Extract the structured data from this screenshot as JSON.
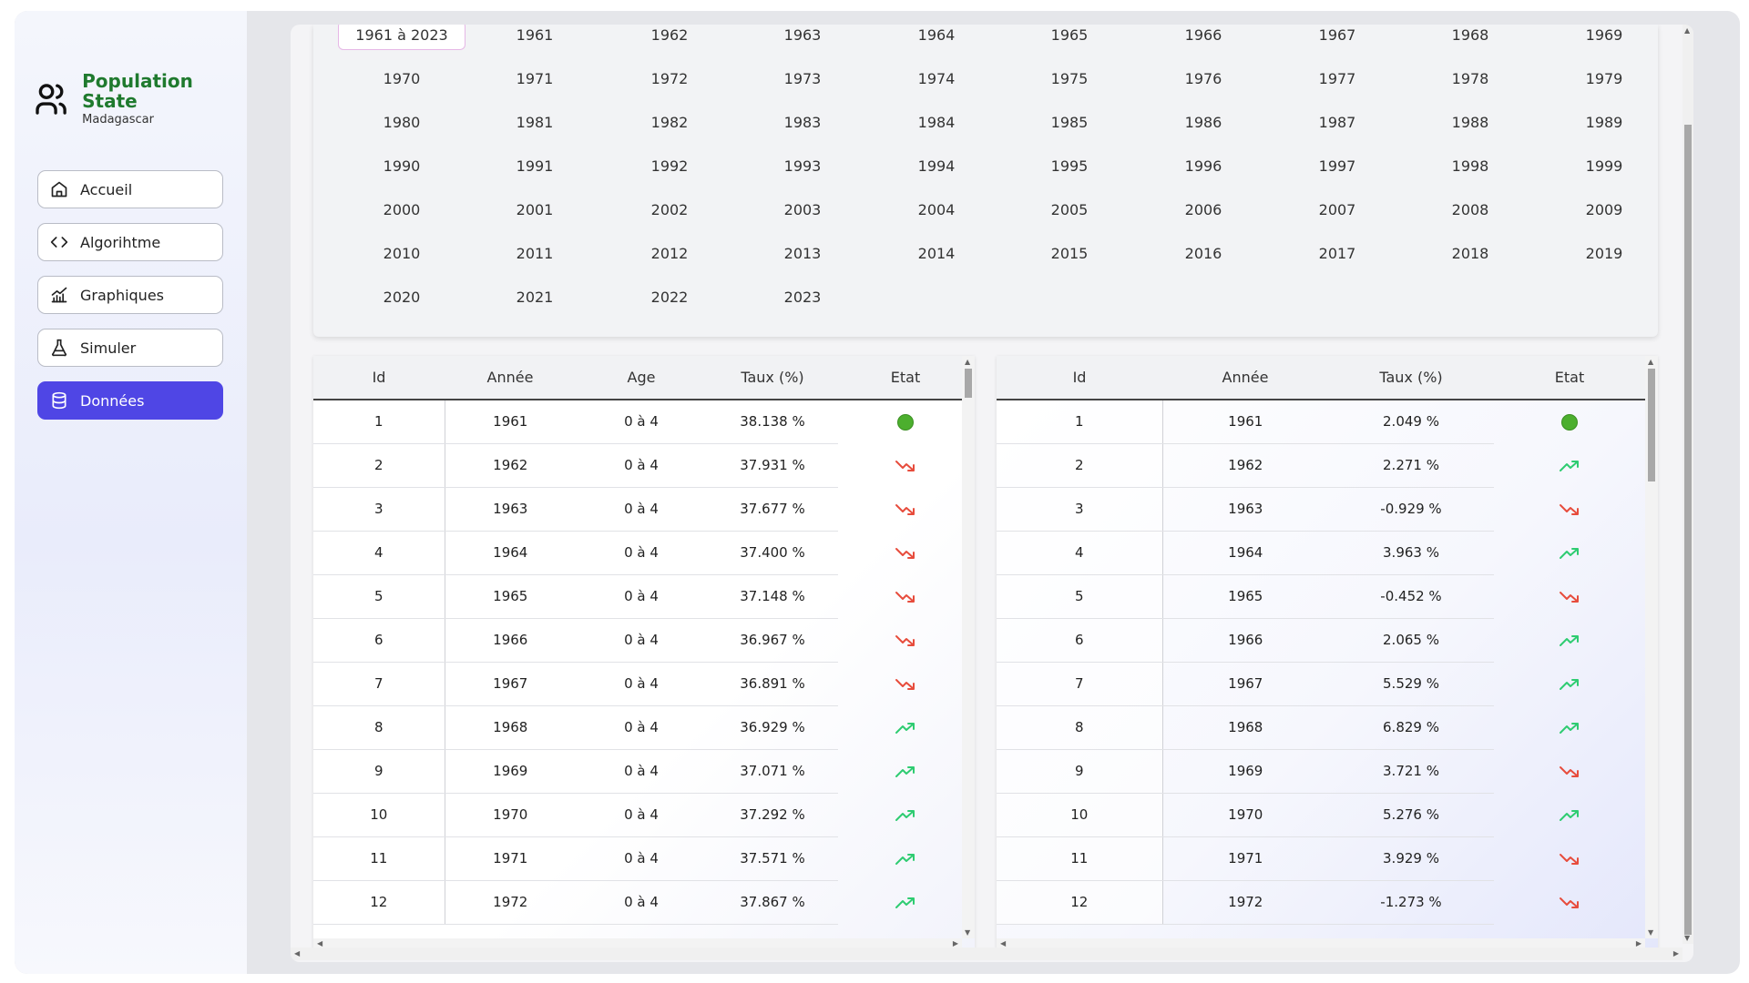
{
  "brand": {
    "title": "Population State",
    "subtitle": "Madagascar"
  },
  "nav": [
    {
      "label": "Accueil",
      "icon": "home-icon",
      "active": false
    },
    {
      "label": "Algorihtme",
      "icon": "code-icon",
      "active": false
    },
    {
      "label": "Graphiques",
      "icon": "chart-icon",
      "active": false
    },
    {
      "label": "Simuler",
      "icon": "flask-icon",
      "active": false
    },
    {
      "label": "Données",
      "icon": "database-icon",
      "active": true
    }
  ],
  "years": {
    "selected": "1961 à 2023",
    "items": [
      "1961 à 2023",
      "1961",
      "1962",
      "1963",
      "1964",
      "1965",
      "1966",
      "1967",
      "1968",
      "1969",
      "1970",
      "1971",
      "1972",
      "1973",
      "1974",
      "1975",
      "1976",
      "1977",
      "1978",
      "1979",
      "1980",
      "1981",
      "1982",
      "1983",
      "1984",
      "1985",
      "1986",
      "1987",
      "1988",
      "1989",
      "1990",
      "1991",
      "1992",
      "1993",
      "1994",
      "1995",
      "1996",
      "1997",
      "1998",
      "1999",
      "2000",
      "2001",
      "2002",
      "2003",
      "2004",
      "2005",
      "2006",
      "2007",
      "2008",
      "2009",
      "2010",
      "2011",
      "2012",
      "2013",
      "2014",
      "2015",
      "2016",
      "2017",
      "2018",
      "2019",
      "2020",
      "2021",
      "2022",
      "2023"
    ]
  },
  "table_age": {
    "headers": [
      "Id",
      "Année",
      "Age",
      "Taux (%)",
      "Etat"
    ],
    "rows": [
      [
        "1",
        "1961",
        "0 à 4",
        "38.138 %",
        "neutral"
      ],
      [
        "2",
        "1962",
        "0 à 4",
        "37.931 %",
        "down"
      ],
      [
        "3",
        "1963",
        "0 à 4",
        "37.677 %",
        "down"
      ],
      [
        "4",
        "1964",
        "0 à 4",
        "37.400 %",
        "down"
      ],
      [
        "5",
        "1965",
        "0 à 4",
        "37.148 %",
        "down"
      ],
      [
        "6",
        "1966",
        "0 à 4",
        "36.967 %",
        "down"
      ],
      [
        "7",
        "1967",
        "0 à 4",
        "36.891 %",
        "down"
      ],
      [
        "8",
        "1968",
        "0 à 4",
        "36.929 %",
        "up"
      ],
      [
        "9",
        "1969",
        "0 à 4",
        "37.071 %",
        "up"
      ],
      [
        "10",
        "1970",
        "0 à 4",
        "37.292 %",
        "up"
      ],
      [
        "11",
        "1971",
        "0 à 4",
        "37.571 %",
        "up"
      ],
      [
        "12",
        "1972",
        "0 à 4",
        "37.867 %",
        "up"
      ]
    ]
  },
  "table_rate": {
    "headers": [
      "Id",
      "Année",
      "Taux (%)",
      "Etat"
    ],
    "rows": [
      [
        "1",
        "1961",
        "2.049 %",
        "neutral"
      ],
      [
        "2",
        "1962",
        "2.271 %",
        "up"
      ],
      [
        "3",
        "1963",
        "-0.929 %",
        "down"
      ],
      [
        "4",
        "1964",
        "3.963 %",
        "up"
      ],
      [
        "5",
        "1965",
        "-0.452 %",
        "down"
      ],
      [
        "6",
        "1966",
        "2.065 %",
        "up"
      ],
      [
        "7",
        "1967",
        "5.529 %",
        "up"
      ],
      [
        "8",
        "1968",
        "6.829 %",
        "up"
      ],
      [
        "9",
        "1969",
        "3.721 %",
        "down"
      ],
      [
        "10",
        "1970",
        "5.276 %",
        "up"
      ],
      [
        "11",
        "1971",
        "3.929 %",
        "down"
      ],
      [
        "12",
        "1972",
        "-1.273 %",
        "down"
      ]
    ]
  },
  "colors": {
    "accent": "#4f46e5",
    "brand": "#1f7a2e",
    "up": "#2ecc71",
    "down": "#e74c3c",
    "neutral": "#4caf2e"
  }
}
